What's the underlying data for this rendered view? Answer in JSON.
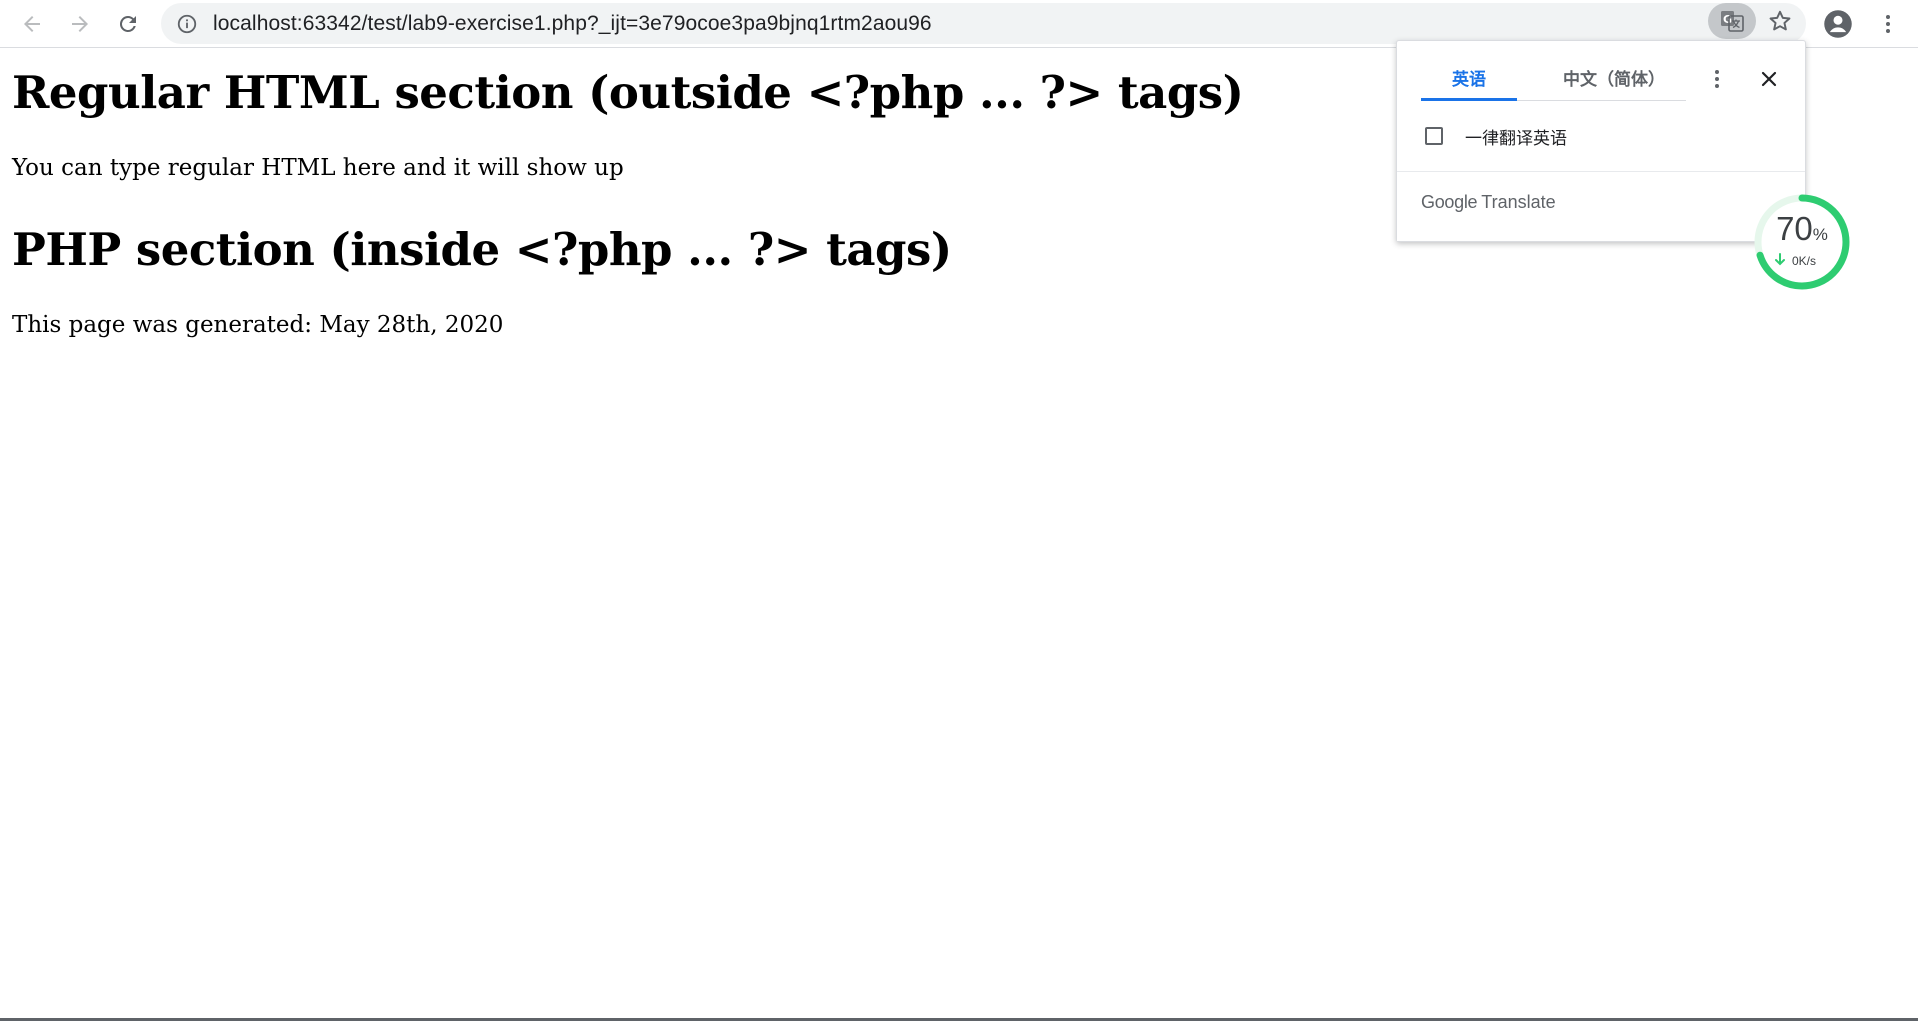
{
  "browser": {
    "url": "localhost:63342/test/lab9-exercise1.php?_ijt=3e79ocoe3pa9bjnq1rtm2aou96",
    "icons": {
      "back": "arrow-left-icon",
      "forward": "arrow-right-icon",
      "reload": "reload-icon",
      "site_info": "info-icon",
      "translate": "translate-icon",
      "bookmark": "star-icon",
      "profile": "account-icon",
      "menu": "kebab-menu-icon"
    }
  },
  "page": {
    "heading_regular": "Regular HTML section (outside <?php ... ?> tags)",
    "text_regular": "You can type regular HTML here and it will show up",
    "heading_php": "PHP section (inside <?php ... ?> tags)",
    "text_php": "This page was generated: May 28th, 2020"
  },
  "translate_popup": {
    "tabs": [
      {
        "label": "英语",
        "active": true
      },
      {
        "label": "中文（简体）",
        "active": false
      }
    ],
    "always_translate_label": "一律翻译英语",
    "always_translate_checked": false,
    "brand_google": "Google",
    "brand_translate": "Translate",
    "accent_color": "#1a73e8"
  },
  "speed_widget": {
    "percent": "70",
    "percent_unit": "%",
    "rate": "0K/s",
    "accent_color": "#2ecc71"
  }
}
